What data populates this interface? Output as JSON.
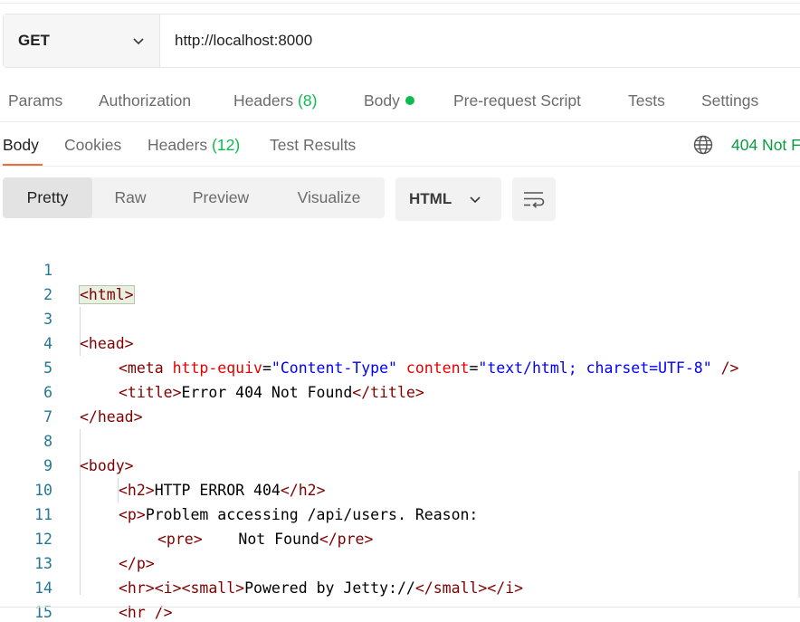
{
  "request": {
    "method": "GET",
    "url": "http://localhost:8000"
  },
  "request_tabs": {
    "params": "Params",
    "authorization": "Authorization",
    "headers_label": "Headers",
    "headers_count": "(8)",
    "body": "Body",
    "pre_request": "Pre-request Script",
    "tests": "Tests",
    "settings": "Settings"
  },
  "response_tabs": {
    "body": "Body",
    "cookies": "Cookies",
    "headers_label": "Headers",
    "headers_count": "(12)",
    "test_results": "Test Results"
  },
  "status": "404 Not F",
  "view_modes": {
    "pretty": "Pretty",
    "raw": "Raw",
    "preview": "Preview",
    "visualize": "Visualize"
  },
  "format": "HTML",
  "code_lines": [
    "1",
    "2",
    "3",
    "4",
    "5",
    "6",
    "7",
    "8",
    "9",
    "10",
    "11",
    "12",
    "13",
    "14",
    "15"
  ],
  "code": {
    "l1_open": "<html>",
    "l3": "<head>",
    "l4_meta": "<meta ",
    "l4_attr1": "http-equiv",
    "l4_eq1": "=",
    "l4_val1": "\"Content-Type\"",
    "l4_attr2": "content",
    "l4_eq2": "=",
    "l4_val2": "\"text/html; charset=UTF-8\"",
    "l4_close": " />",
    "l5_open": "<title>",
    "l5_text": "Error 404 Not Found",
    "l5_close": "</title>",
    "l6": "</head>",
    "l8": "<body>",
    "l9_open": "<h2>",
    "l9_text": "HTTP ERROR 404",
    "l9_close": "</h2>",
    "l10_open": "<p>",
    "l10_text": "Problem accessing /api/users. Reason:",
    "l11_open": "<pre>",
    "l11_text": "    Not Found",
    "l11_close": "</pre>",
    "l12": "</p>",
    "l13_hr": "<hr>",
    "l13_i": "<i>",
    "l13_small": "<small>",
    "l13_text": "Powered by Jetty://",
    "l13_small_close": "</small>",
    "l13_i_close": "</i>",
    "l14": "<hr />"
  },
  "colors": {
    "accent": "#f26b3a",
    "success": "#0cbb52",
    "tag": "#800000",
    "attr": "#e50000",
    "string": "#0000ff",
    "line_number": "#237893"
  }
}
